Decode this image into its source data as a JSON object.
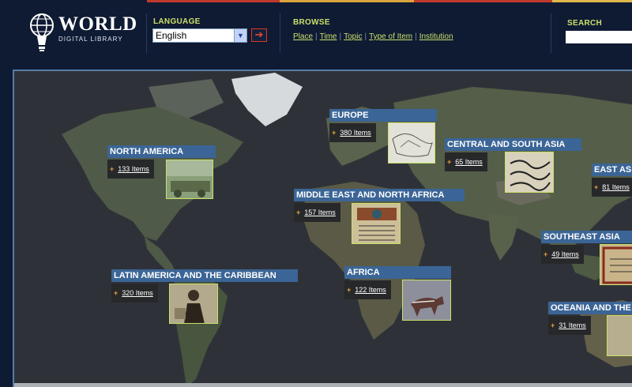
{
  "header": {
    "logo": {
      "word": "WORLD",
      "sub": "DIGITAL LIBRARY",
      "icon": "globe-lightbulb-icon"
    },
    "language": {
      "label": "LANGUAGE",
      "selected": "English",
      "go_icon": "arrow-right-icon"
    },
    "browse": {
      "label": "BROWSE",
      "links": [
        "Place",
        "Time",
        "Topic",
        "Type of Item",
        "Institution"
      ]
    },
    "search": {
      "label": "SEARCH",
      "value": ""
    }
  },
  "colors": {
    "background": "#0f1a33",
    "accent_green": "#c9e06b",
    "region_title_blue": "#3b6596",
    "plus_orange": "#e7a23b",
    "stripe": [
      "#c0392b",
      "#d9a43b",
      "#c0392b",
      "#e0b84a"
    ]
  },
  "regions": [
    {
      "name": "NORTH AMERICA",
      "count": "133 Items",
      "thumb": "wagon-photo"
    },
    {
      "name": "EUROPE",
      "count": "380 Items",
      "thumb": "map-drawing"
    },
    {
      "name": "CENTRAL AND SOUTH ASIA",
      "count": "65 Items",
      "thumb": "calligraphy"
    },
    {
      "name": "EAST ASIA",
      "count": "81 Items",
      "thumb": ""
    },
    {
      "name": "MIDDLE EAST AND NORTH AFRICA",
      "count": "157 Items",
      "thumb": "manuscript"
    },
    {
      "name": "LATIN AMERICA AND THE CARIBBEAN",
      "count": "320 Items",
      "thumb": "portrait-photo"
    },
    {
      "name": "AFRICA",
      "count": "122 Items",
      "thumb": "rock-painting"
    },
    {
      "name": "SOUTHEAST ASIA",
      "count": "49 Items",
      "thumb": "illuminated-page"
    },
    {
      "name": "OCEANIA AND THE PACIFIC",
      "count": "31 Items",
      "thumb": ""
    }
  ]
}
